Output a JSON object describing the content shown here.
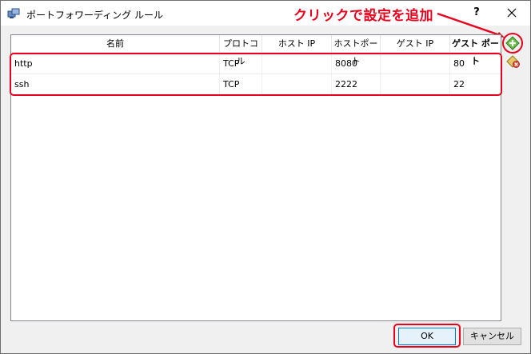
{
  "window": {
    "title": "ポートフォワーディング ルール",
    "help_label": "?"
  },
  "annotation": {
    "text": "クリックで設定を追加",
    "color": "#e8001c"
  },
  "table": {
    "headers": [
      "名前",
      "プロトコル",
      "ホスト IP",
      "ホストポート",
      "ゲスト IP",
      "ゲスト ポート"
    ],
    "rows": [
      {
        "name": "http",
        "protocol": "TCP",
        "host_ip": "",
        "host_port": "8080",
        "guest_ip": "",
        "guest_port": "80"
      },
      {
        "name": "ssh",
        "protocol": "TCP",
        "host_ip": "",
        "host_port": "2222",
        "guest_ip": "",
        "guest_port": "22"
      }
    ]
  },
  "side_buttons": {
    "add_icon": "add-rule-icon",
    "remove_icon": "remove-rule-icon"
  },
  "buttons": {
    "ok": "OK",
    "cancel": "キャンセル"
  },
  "colors": {
    "highlight": "#e8001c",
    "accent": "#0078d7"
  }
}
